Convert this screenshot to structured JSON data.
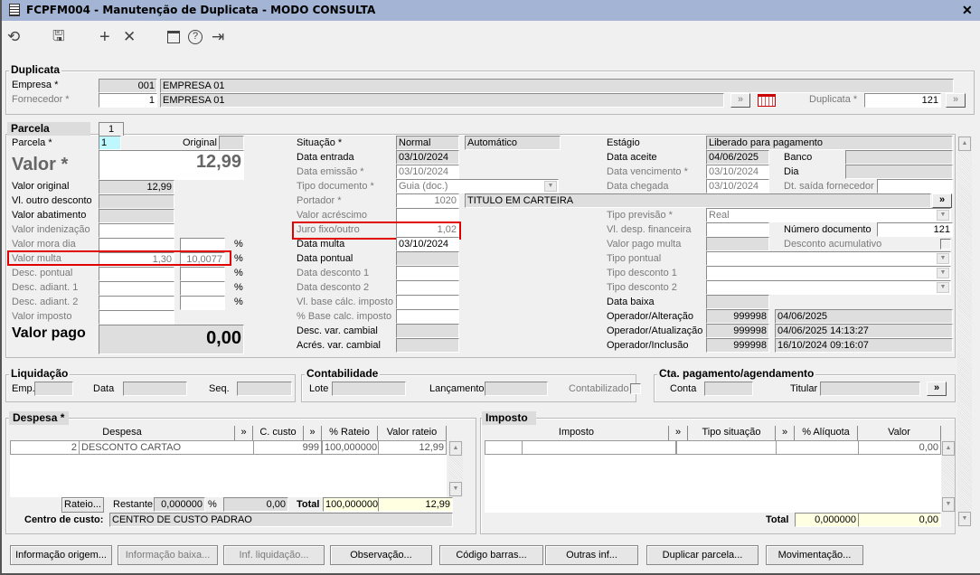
{
  "window": {
    "title": "FCPFM004 - Manutenção de Duplicata - MODO CONSULTA",
    "close": "✕"
  },
  "toolbar": {
    "icons": [
      "undo-icon",
      "save-icon",
      "add-icon",
      "delete-icon",
      "calendar-icon",
      "help-icon",
      "exit-icon"
    ],
    "glyphs": {
      "undo": "⟲",
      "save": "🖫",
      "add": "+",
      "delete": "✕",
      "calendar": "▭",
      "help": "?",
      "exit": "⇥"
    }
  },
  "more": "»",
  "duplicata": {
    "legend": "Duplicata",
    "empresa_label": "Empresa *",
    "empresa_code": "001",
    "empresa_name": "EMPRESA 01",
    "fornecedor_label": "Fornecedor *",
    "fornecedor_code": "1",
    "fornecedor_name": "EMPRESA 01",
    "duplicata_label": "Duplicata *",
    "duplicata_value": "121"
  },
  "parcela": {
    "tab": "Parcela",
    "tab_number": "1",
    "left": {
      "parcela_label": "Parcela *",
      "parcela_value": "1",
      "original_label": "Original",
      "original_value": "",
      "valor_label": "Valor *",
      "valor_value": "12,99",
      "valor_original_label": "Valor original",
      "valor_original_value": "12,99",
      "outro_desconto_label": "Vl. outro desconto",
      "abatimento_label": "Valor abatimento",
      "indenizacao_label": "Valor indenização",
      "mora_label": "Valor mora dia",
      "multa_label": "Valor multa",
      "multa_value": "1,30",
      "multa_pct": "10,0077",
      "desc_pontual_label": "Desc. pontual",
      "desc_adiant1_label": "Desc. adiant. 1",
      "desc_adiant2_label": "Desc. adiant. 2",
      "imposto_label": "Valor imposto",
      "pago_label": "Valor pago",
      "pago_value": "0,00",
      "pct": "%"
    },
    "middle": {
      "situacao_label": "Situação *",
      "situacao_value": "Normal",
      "situacao_mode": "Automático",
      "entrada_label": "Data entrada",
      "entrada_value": "03/10/2024",
      "emissao_label": "Data emissão *",
      "emissao_value": "03/10/2024",
      "tipo_doc_label": "Tipo documento *",
      "tipo_doc_value": "Guia (doc.)",
      "portador_label": "Portador *",
      "portador_code": "1020",
      "portador_name": "TITULO EM CARTEIRA",
      "acrescimo_label": "Valor acréscimo",
      "juro_label": "Juro fixo/outro",
      "juro_value": "1,02",
      "data_multa_label": "Data multa",
      "data_multa_value": "03/10/2024",
      "data_pontual_label": "Data pontual",
      "desc1_label": "Data desconto 1",
      "desc2_label": "Data desconto 2",
      "base_imposto_label": "Vl. base cálc. imposto",
      "pct_base_label": "% Base calc. imposto",
      "desc_cambial_label": "Desc. var. cambial",
      "acres_cambial_label": "Acrés. var. cambial"
    },
    "right": {
      "estagio_label": "Estágio",
      "estagio_value": "Liberado para pagamento",
      "aceite_label": "Data aceite",
      "aceite_value": "04/06/2025",
      "banco_label": "Banco",
      "dia_label": "Dia",
      "vencimento_label": "Data vencimento *",
      "vencimento_value": "03/10/2024",
      "chegada_label": "Data chegada",
      "chegada_value": "03/10/2024",
      "saida_label": "Dt. saída fornecedor",
      "previsao_label": "Tipo previsão *",
      "previsao_value": "Real",
      "desp_fin_label": "Vl. desp. financeira",
      "num_doc_label": "Número documento",
      "num_doc_value": "121",
      "pago_multa_label": "Valor pago multa",
      "desc_acum_label": "Desconto acumulativo",
      "tipo_pontual_label": "Tipo pontual",
      "tipo_desc1_label": "Tipo desconto 1",
      "tipo_desc2_label": "Tipo desconto 2",
      "baixa_label": "Data baixa",
      "op_alt_label": "Operador/Alteração",
      "op_alt_code": "999998",
      "op_alt_value": "04/06/2025",
      "op_atu_label": "Operador/Atualização",
      "op_atu_code": "999998",
      "op_atu_value": "04/06/2025 14:13:27",
      "op_inc_label": "Operador/Inclusão",
      "op_inc_code": "999998",
      "op_inc_value": "16/10/2024 09:16:07"
    }
  },
  "liquidacao": {
    "legend": "Liquidação",
    "emp_label": "Emp.",
    "data_label": "Data",
    "seq_label": "Seq."
  },
  "contabilidade": {
    "legend": "Contabilidade",
    "lote_label": "Lote",
    "lancamento_label": "Lançamento",
    "contabilizado_label": "Contabilizado"
  },
  "cta": {
    "legend": "Cta. pagamento/agendamento",
    "conta_label": "Conta",
    "titular_label": "Titular"
  },
  "despesa": {
    "tab": "Despesa *",
    "columns": [
      "Despesa",
      "C. custo",
      "% Rateio",
      "Valor rateio"
    ],
    "rows": [
      {
        "code": "2",
        "name": "DESCONTO CARTAO",
        "ccusto": "999",
        "rateio": "100,000000",
        "valor": "12,99"
      }
    ],
    "rateio_button": "Rateio...",
    "restante_label": "Restante",
    "restante_pct": "0,000000",
    "pct": "%",
    "restante_valor": "0,00",
    "total_label": "Total",
    "total_pct": "100,000000",
    "total_valor": "12,99",
    "centro_label": "Centro de custo:",
    "centro_value": "CENTRO DE CUSTO PADRAO"
  },
  "imposto": {
    "tab": "Imposto",
    "columns": [
      "Imposto",
      "Tipo situação",
      "% Alíquota",
      "Valor"
    ],
    "rows": [
      {
        "valor": "0,00"
      }
    ],
    "total_label": "Total",
    "total_pct": "0,000000",
    "total_valor": "0,00"
  },
  "buttons": [
    {
      "label": "Informação origem...",
      "enabled": true
    },
    {
      "label": "Informação baixa...",
      "enabled": false
    },
    {
      "label": "Inf. liquidação...",
      "enabled": false
    },
    {
      "label": "Observação...",
      "enabled": true
    },
    {
      "label": "Código barras...",
      "enabled": true
    },
    {
      "label": "Outras inf...",
      "enabled": true
    },
    {
      "label": "Duplicar parcela...",
      "enabled": true
    },
    {
      "label": "Movimentação...",
      "enabled": true
    }
  ],
  "colors": {
    "title_bar": "#a3b4d4",
    "highlight_red": "#e00000",
    "total_yellow": "#ffffe1",
    "selected_cyan": "#bff7ff"
  }
}
